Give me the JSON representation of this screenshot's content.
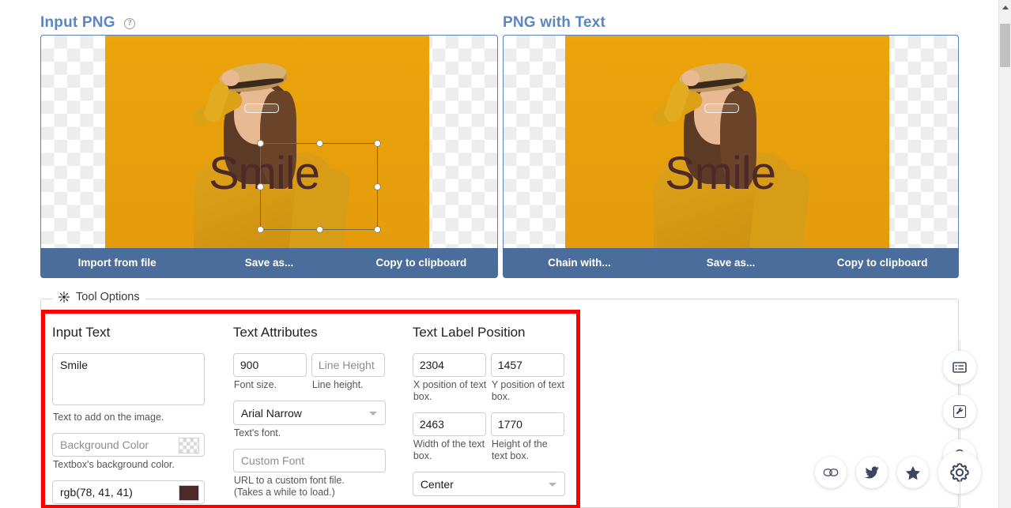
{
  "panels": {
    "left": {
      "title": "Input PNG",
      "help_icon": "help-circle-icon",
      "overlay_text": "Smile",
      "toolbar": [
        "Import from file",
        "Save as...",
        "Copy to clipboard"
      ]
    },
    "right": {
      "title": "PNG with Text",
      "overlay_text": "Smile",
      "toolbar": [
        "Chain with...",
        "Save as...",
        "Copy to clipboard"
      ]
    }
  },
  "tool_options": {
    "legend": "Tool Options",
    "legend_icon": "magic-wand-icon",
    "highlight_color": "#fb0000",
    "columns": {
      "input_text": {
        "title": "Input Text",
        "text_value": "Smile",
        "text_hint": "Text to add on the image.",
        "background_color_placeholder": "Background Color",
        "background_color_value": "",
        "background_color_hint": "Textbox's background color.",
        "font_color_value": "rgb(78, 41, 41)",
        "font_color_swatch": "#4e2929"
      },
      "text_attributes": {
        "title": "Text Attributes",
        "font_size_value": "900",
        "font_size_hint": "Font size.",
        "line_height_placeholder": "Line Height",
        "line_height_value": "",
        "line_height_hint": "Line height.",
        "font_select_value": "Arial Narrow",
        "font_select_hint": "Text's font.",
        "custom_font_placeholder": "Custom Font",
        "custom_font_value": "",
        "custom_font_hint_1": "URL to a custom font file.",
        "custom_font_hint_2": "(Takes a while to load.)"
      },
      "text_label_position": {
        "title": "Text Label Position",
        "x_value": "2304",
        "x_hint": "X position of text box.",
        "y_value": "1457",
        "y_hint": "Y position of text box.",
        "width_value": "2463",
        "width_hint": "Width of the text box.",
        "height_value": "1770",
        "height_hint": "Height of the text box.",
        "align_value": "Center"
      }
    }
  },
  "rail": {
    "items": [
      {
        "name": "list-icon"
      },
      {
        "name": "wrench-icon"
      },
      {
        "name": "lightbulb-icon"
      }
    ]
  },
  "social": {
    "items": [
      {
        "name": "link-chain-icon"
      },
      {
        "name": "twitter-icon"
      },
      {
        "name": "star-icon"
      },
      {
        "name": "gear-icon"
      }
    ]
  },
  "colors": {
    "panel_title": "#5b86c4",
    "toolbar": "#4b6d9b",
    "photo_background": "#e8a00c",
    "overlay_text": "#4e2929"
  }
}
